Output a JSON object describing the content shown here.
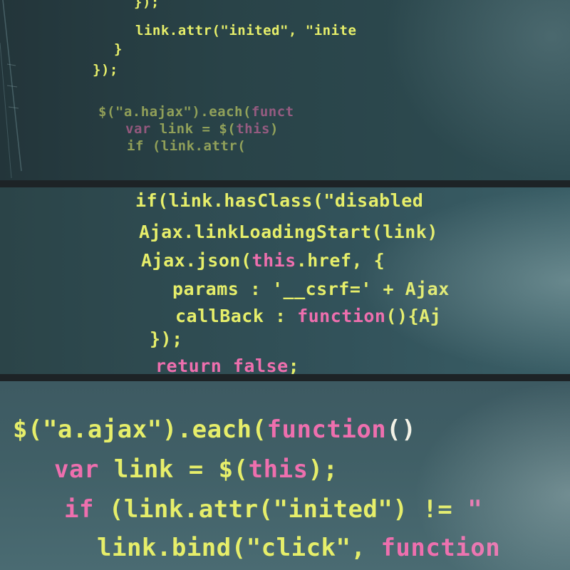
{
  "panels": [
    {
      "lines": [
        [
          {
            "t": "});",
            "c": "y"
          }
        ],
        [
          {
            "t": "link.attr(\"inited\", \"inite",
            "c": "y"
          }
        ],
        [
          {
            "t": "}",
            "c": "y"
          }
        ],
        [
          {
            "t": "});",
            "c": "y"
          }
        ],
        [
          {
            "t": "$(\"a.hajax\").each(",
            "c": "y"
          },
          {
            "t": "funct",
            "c": "p"
          }
        ],
        [
          {
            "t": "var ",
            "c": "p"
          },
          {
            "t": "link = $(",
            "c": "y"
          },
          {
            "t": "this",
            "c": "p"
          },
          {
            "t": ")",
            "c": "y"
          }
        ],
        [
          {
            "t": "if (link.attr(",
            "c": "y"
          }
        ]
      ]
    },
    {
      "lines": [
        [
          {
            "t": "if(link.hasClass(\"disabled",
            "c": "y"
          }
        ],
        [
          {
            "t": "Ajax.linkLoadingStart(link)",
            "c": "y"
          }
        ],
        [
          {
            "t": "Ajax.json(",
            "c": "y"
          },
          {
            "t": "this",
            "c": "p"
          },
          {
            "t": ".href, {",
            "c": "y"
          }
        ],
        [
          {
            "t": "params : '__csrf=' + Ajax",
            "c": "y"
          }
        ],
        [
          {
            "t": "callBack : ",
            "c": "y"
          },
          {
            "t": "function",
            "c": "p"
          },
          {
            "t": "(){Aj",
            "c": "y"
          }
        ],
        [
          {
            "t": "});",
            "c": "y"
          }
        ],
        [
          {
            "t": "return false",
            "c": "p"
          },
          {
            "t": ";",
            "c": "y"
          }
        ]
      ]
    },
    {
      "lines": [
        [
          {
            "t": "$(\"a.ajax\").each(",
            "c": "y"
          },
          {
            "t": "function",
            "c": "p"
          },
          {
            "t": "()",
            "c": "w"
          }
        ],
        [
          {
            "t": "var ",
            "c": "p"
          },
          {
            "t": "link = $(",
            "c": "y"
          },
          {
            "t": "this",
            "c": "p"
          },
          {
            "t": ");",
            "c": "y"
          }
        ],
        [
          {
            "t": "if",
            "c": "p"
          },
          {
            "t": " (link.attr(\"inited\") != ",
            "c": "y"
          },
          {
            "t": "\"",
            "c": "p"
          }
        ],
        [
          {
            "t": "link.bind(\"click\", ",
            "c": "y"
          },
          {
            "t": "function",
            "c": "p"
          }
        ]
      ]
    }
  ],
  "colors": {
    "yellow": "#e6ee6a",
    "pink": "#ee6fae",
    "white": "#f2f2e6"
  }
}
